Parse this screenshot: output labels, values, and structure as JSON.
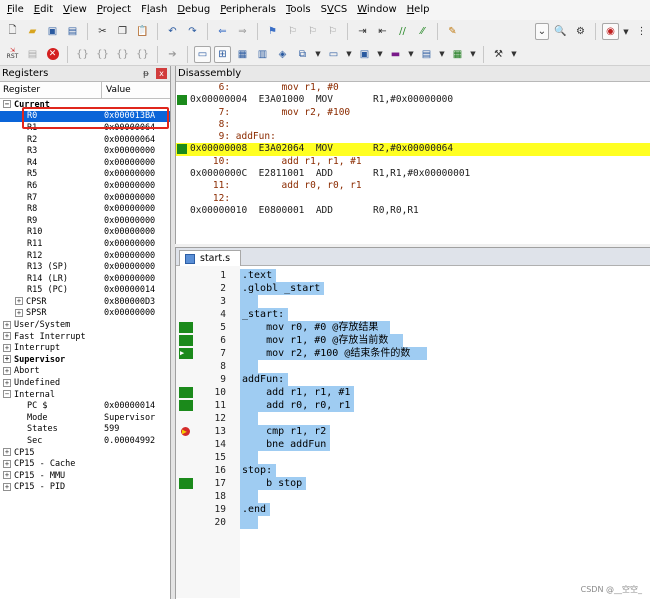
{
  "menu": [
    "File",
    "Edit",
    "View",
    "Project",
    "Flash",
    "Debug",
    "Peripherals",
    "Tools",
    "SVCS",
    "Window",
    "Help"
  ],
  "toolbar2": {
    "rst_label": "RST"
  },
  "registers": {
    "title": "Registers",
    "pin": "ᵽ",
    "close": "x",
    "col_register": "Register",
    "col_value": "Value",
    "rows": [
      {
        "name": "Current",
        "value": "",
        "indent": 0,
        "exp": "-",
        "bold": true
      },
      {
        "name": "R0",
        "value": "0x000013BA",
        "indent": 2,
        "exp": "",
        "selected": true
      },
      {
        "name": "R1",
        "value": "0x00000064",
        "indent": 2,
        "exp": ""
      },
      {
        "name": "R2",
        "value": "0x00000064",
        "indent": 2,
        "exp": ""
      },
      {
        "name": "R3",
        "value": "0x00000000",
        "indent": 2,
        "exp": ""
      },
      {
        "name": "R4",
        "value": "0x00000000",
        "indent": 2,
        "exp": ""
      },
      {
        "name": "R5",
        "value": "0x00000000",
        "indent": 2,
        "exp": ""
      },
      {
        "name": "R6",
        "value": "0x00000000",
        "indent": 2,
        "exp": ""
      },
      {
        "name": "R7",
        "value": "0x00000000",
        "indent": 2,
        "exp": ""
      },
      {
        "name": "R8",
        "value": "0x00000000",
        "indent": 2,
        "exp": ""
      },
      {
        "name": "R9",
        "value": "0x00000000",
        "indent": 2,
        "exp": ""
      },
      {
        "name": "R10",
        "value": "0x00000000",
        "indent": 2,
        "exp": ""
      },
      {
        "name": "R11",
        "value": "0x00000000",
        "indent": 2,
        "exp": ""
      },
      {
        "name": "R12",
        "value": "0x00000000",
        "indent": 2,
        "exp": ""
      },
      {
        "name": "R13 (SP)",
        "value": "0x00000000",
        "indent": 2,
        "exp": ""
      },
      {
        "name": "R14 (LR)",
        "value": "0x00000000",
        "indent": 2,
        "exp": ""
      },
      {
        "name": "R15 (PC)",
        "value": "0x00000014",
        "indent": 2,
        "exp": ""
      },
      {
        "name": "CPSR",
        "value": "0x800000D3",
        "indent": 1,
        "exp": "+"
      },
      {
        "name": "SPSR",
        "value": "0x00000000",
        "indent": 1,
        "exp": "+"
      },
      {
        "name": "User/System",
        "value": "",
        "indent": 0,
        "exp": "+"
      },
      {
        "name": "Fast Interrupt",
        "value": "",
        "indent": 0,
        "exp": "+"
      },
      {
        "name": "Interrupt",
        "value": "",
        "indent": 0,
        "exp": "+"
      },
      {
        "name": "Supervisor",
        "value": "",
        "indent": 0,
        "exp": "+",
        "bold": true
      },
      {
        "name": "Abort",
        "value": "",
        "indent": 0,
        "exp": "+"
      },
      {
        "name": "Undefined",
        "value": "",
        "indent": 0,
        "exp": "+"
      },
      {
        "name": "Internal",
        "value": "",
        "indent": 0,
        "exp": "-"
      },
      {
        "name": "PC  $",
        "value": "0x00000014",
        "indent": 2,
        "exp": ""
      },
      {
        "name": "Mode",
        "value": "Supervisor",
        "indent": 2,
        "exp": ""
      },
      {
        "name": "States",
        "value": "599",
        "indent": 2,
        "exp": ""
      },
      {
        "name": "Sec",
        "value": "0.00004992",
        "indent": 2,
        "exp": ""
      },
      {
        "name": "CP15",
        "value": "",
        "indent": 0,
        "exp": "+"
      },
      {
        "name": "CP15 - Cache",
        "value": "",
        "indent": 0,
        "exp": "+"
      },
      {
        "name": "CP15 - MMU",
        "value": "",
        "indent": 0,
        "exp": "+"
      },
      {
        "name": "CP15 - PID",
        "value": "",
        "indent": 0,
        "exp": "+"
      }
    ]
  },
  "disassembly": {
    "title": "Disassembly",
    "lines": [
      {
        "text": "     6:         mov r1, #0",
        "kind": "src"
      },
      {
        "text": "0x00000004  E3A01000  MOV       R1,#0x00000000",
        "kind": "asm",
        "mark": true
      },
      {
        "text": "     7:         mov r2, #100",
        "kind": "src"
      },
      {
        "text": "     8:",
        "kind": "src"
      },
      {
        "text": "     9: addFun:",
        "kind": "src"
      },
      {
        "text": "0x00000008  E3A02064  MOV       R2,#0x00000064",
        "kind": "asm",
        "mark": true,
        "highlight": true
      },
      {
        "text": "    10:         add r1, r1, #1",
        "kind": "src"
      },
      {
        "text": "0x0000000C  E2811001  ADD       R1,R1,#0x00000001",
        "kind": "asm"
      },
      {
        "text": "    11:         add r0, r0, r1",
        "kind": "src"
      },
      {
        "text": "    12:",
        "kind": "src"
      },
      {
        "text": "0x00000010  E0800001  ADD       R0,R0,R1",
        "kind": "asm"
      }
    ]
  },
  "editor": {
    "tab": "start.s",
    "lines": [
      {
        "num": "1",
        "text": ".text"
      },
      {
        "num": "2",
        "text": ".globl _start"
      },
      {
        "num": "3",
        "text": ""
      },
      {
        "num": "4",
        "text": "_start:"
      },
      {
        "num": "5",
        "text": "    mov r0, #0 @存放结果",
        "mark": "green"
      },
      {
        "num": "6",
        "text": "    mov r1, #0 @存放当前数",
        "mark": "green"
      },
      {
        "num": "7",
        "text": "    mov r2, #100 @结束条件的数",
        "mark": "arrow"
      },
      {
        "num": "8",
        "text": ""
      },
      {
        "num": "9",
        "text": "addFun:"
      },
      {
        "num": "10",
        "text": "    add r1, r1, #1",
        "mark": "green"
      },
      {
        "num": "11",
        "text": "    add r0, r0, r1",
        "mark": "green"
      },
      {
        "num": "12",
        "text": ""
      },
      {
        "num": "13",
        "text": "    cmp r1, r2",
        "mark": "bp"
      },
      {
        "num": "14",
        "text": "    bne addFun"
      },
      {
        "num": "15",
        "text": ""
      },
      {
        "num": "16",
        "text": "stop:"
      },
      {
        "num": "17",
        "text": "    b stop",
        "mark": "green"
      },
      {
        "num": "18",
        "text": ""
      },
      {
        "num": "19",
        "text": ".end"
      },
      {
        "num": "20",
        "text": ""
      }
    ]
  },
  "watermark": "CSDN @__空空_"
}
